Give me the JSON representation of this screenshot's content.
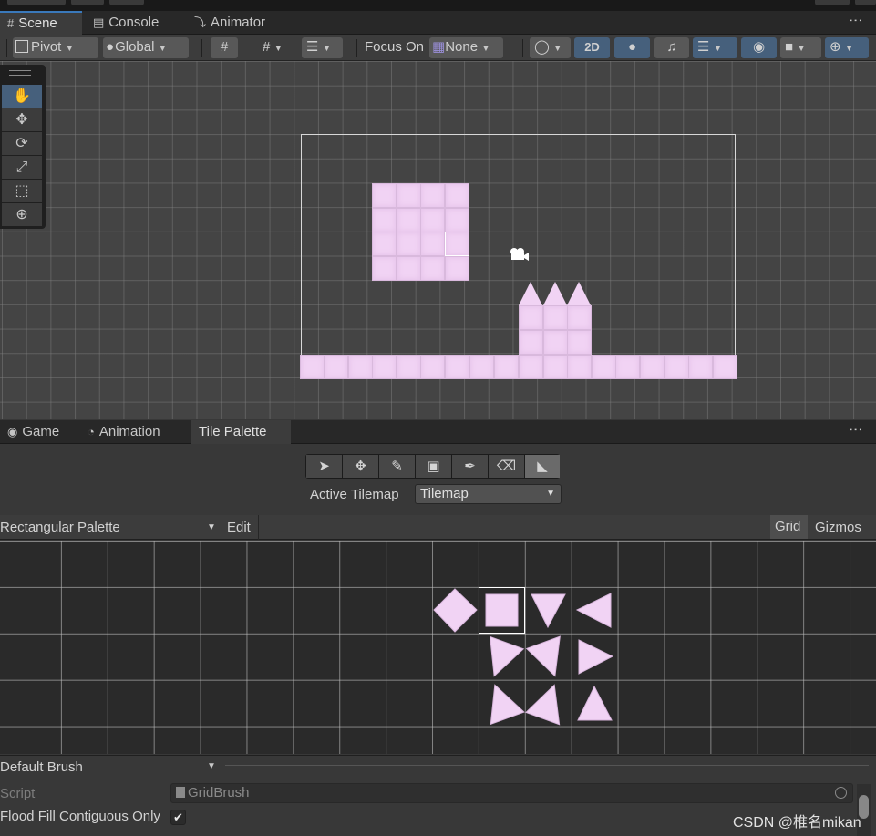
{
  "tabs_top": [
    {
      "label": "Scene",
      "icon": "grid-icon",
      "active": true
    },
    {
      "label": "Console",
      "icon": "console-icon",
      "active": false
    },
    {
      "label": "Animator",
      "icon": "animator-icon",
      "active": false
    }
  ],
  "scene_toolbar": {
    "pivot": "Pivot",
    "global": "Global",
    "focus_on_label": "Focus On",
    "focus_on_value": "None",
    "mode_2d": "2D"
  },
  "tool_palette": [
    "hand-tool",
    "move-tool",
    "rotate-tool",
    "scale-tool",
    "rect-tool",
    "transform-tool"
  ],
  "tabs_bottom": [
    {
      "label": "Game",
      "icon": "gamepad-icon",
      "active": false
    },
    {
      "label": "Animation",
      "icon": "clock-icon",
      "active": false
    },
    {
      "label": "Tile Palette",
      "icon": "",
      "active": true
    }
  ],
  "tile_palette": {
    "tools": [
      "select",
      "move",
      "paint",
      "box-fill",
      "picker",
      "erase",
      "flood-fill"
    ],
    "selected_tool": "flood-fill",
    "active_tilemap_label": "Active Tilemap",
    "active_tilemap_value": "Tilemap",
    "palette_name": "Rectangular Palette",
    "edit_label": "Edit",
    "grid_label": "Grid",
    "gizmos_label": "Gizmos",
    "brush_name": "Default Brush",
    "script_label": "Script",
    "script_value": "GridBrush",
    "flood_fill_label": "Flood Fill Contiguous Only",
    "flood_fill_checked": true
  },
  "colors": {
    "tile": "#f1d3f4",
    "accent": "#3a79bb",
    "selected_button": "#46607c"
  },
  "watermark": "CSDN @椎名mikan"
}
